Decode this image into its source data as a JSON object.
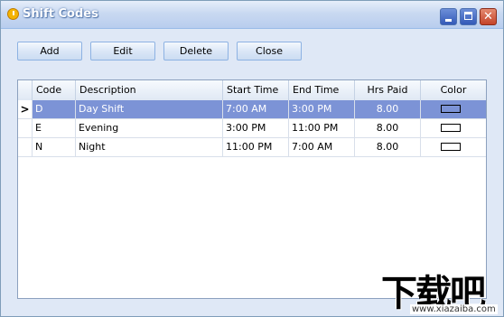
{
  "window": {
    "title": "Shift Codes"
  },
  "toolbar": {
    "add": "Add",
    "edit": "Edit",
    "delete": "Delete",
    "close": "Close"
  },
  "grid": {
    "columns": [
      "Code",
      "Description",
      "Start Time",
      "End Time",
      "Hrs Paid",
      "Color"
    ],
    "rows": [
      {
        "code": "D",
        "description": "Day Shift",
        "start": "7:00 AM",
        "end": "3:00 PM",
        "hrs": "8.00",
        "selected": true
      },
      {
        "code": "E",
        "description": "Evening",
        "start": "3:00 PM",
        "end": "11:00 PM",
        "hrs": "8.00",
        "selected": false
      },
      {
        "code": "N",
        "description": "Night",
        "start": "11:00 PM",
        "end": "7:00 AM",
        "hrs": "8.00",
        "selected": false
      }
    ],
    "current_row_indicator": ">"
  },
  "colors": {
    "selection": "#7c93d6",
    "titlebar": "#c9d9f1",
    "background": "#dfe8f6"
  },
  "icons": [
    "clock-icon",
    "minimize-icon",
    "maximize-icon",
    "close-icon",
    "row-pointer-icon"
  ],
  "watermark": {
    "main": "下载吧",
    "sub": "www.xiazaiba.com"
  }
}
